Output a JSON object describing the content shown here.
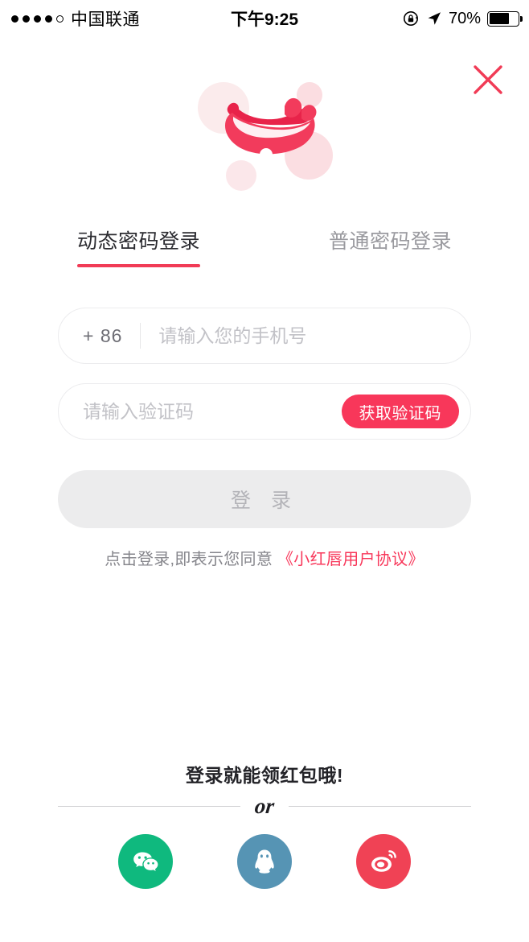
{
  "status_bar": {
    "signal_dots_filled": 4,
    "signal_dots_total": 5,
    "carrier": "中国联通",
    "time": "下午9:25",
    "battery_percent": "70%",
    "battery_level": 70,
    "rotation_lock_icon": "rotation-lock-icon",
    "location_icon": "location-arrow-icon"
  },
  "header": {
    "close_icon": "close-icon",
    "close_color": "#F13B56",
    "logo_name": "xiaohongchun-lips-logo"
  },
  "tabs": [
    {
      "label": "动态密码登录",
      "active": true
    },
    {
      "label": "普通密码登录",
      "active": false
    }
  ],
  "form": {
    "country_code": "+ 86",
    "phone_placeholder": "请输入您的手机号",
    "phone_value": "",
    "code_placeholder": "请输入验证码",
    "code_value": "",
    "get_code_label": "获取验证码",
    "login_label": "登 录",
    "login_disabled": true
  },
  "agreement": {
    "prefix": "点击登录,即表示您同意 ",
    "link": "《小红唇用户协议》"
  },
  "bottom": {
    "promo": "登录就能领红包哦!",
    "or_label": "or",
    "socials": [
      {
        "name": "wechat",
        "label": "微信",
        "color": "#0FB97E"
      },
      {
        "name": "qq",
        "label": "QQ",
        "color": "#5694B4"
      },
      {
        "name": "weibo",
        "label": "微博",
        "color": "#F04255"
      }
    ]
  },
  "colors": {
    "accent": "#F8375A",
    "tab_underline": "#F13B56",
    "disabled_button": "#ececed",
    "text_primary": "#2b2b30",
    "text_muted": "#9a9a9f"
  }
}
